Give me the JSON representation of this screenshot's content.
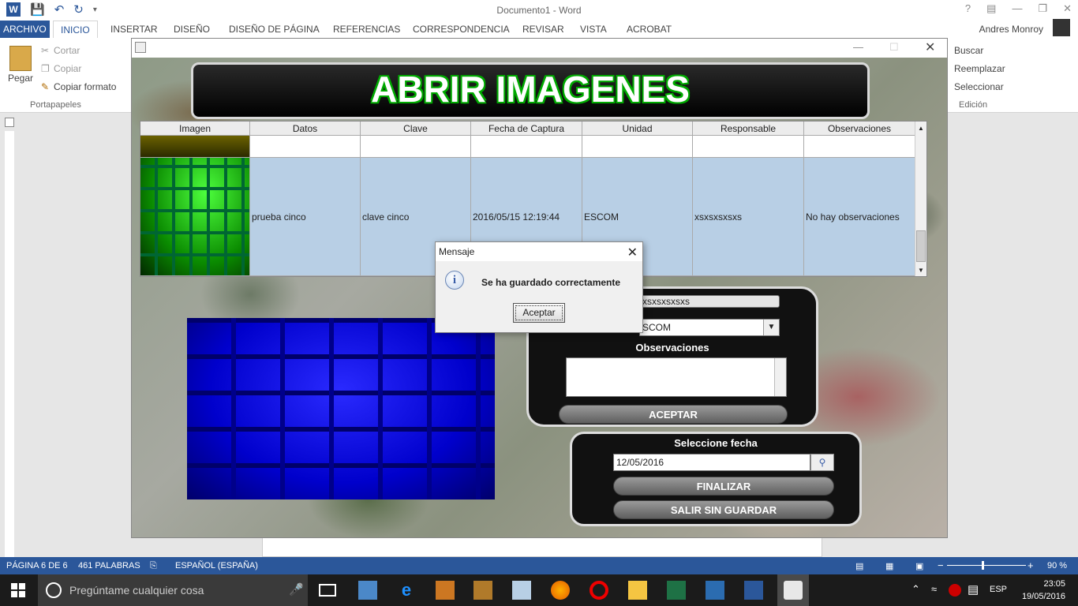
{
  "word": {
    "doc_title": "Documento1 - Word",
    "tabs": [
      "ARCHIVO",
      "INICIO",
      "INSERTAR",
      "DISEÑO",
      "DISEÑO DE PÁGINA",
      "REFERENCIAS",
      "CORRESPONDENCIA",
      "REVISAR",
      "VISTA",
      "ACROBAT"
    ],
    "user": "Andres Monroy",
    "ribbon": {
      "paste": "Pegar",
      "cut": "Cortar",
      "copy": "Copiar",
      "format_painter": "Copiar formato",
      "group_clipboard": "Portapapeles",
      "find": "Buscar",
      "replace": "Reemplazar",
      "select": "Seleccionar",
      "group_edit": "Edición"
    },
    "status": {
      "page": "PÁGINA 6 DE 6",
      "words": "461 PALABRAS",
      "language": "ESPAÑOL (ESPAÑA)",
      "zoom": "90 %"
    }
  },
  "taskbar": {
    "search_placeholder": "Pregúntame cualquier cosa",
    "lang": "ESP",
    "time": "23:05",
    "date": "19/05/2016"
  },
  "app": {
    "banner": "ABRIR IMAGENES",
    "table": {
      "headers": [
        "Imagen",
        "Datos",
        "Clave",
        "Fecha de Captura",
        "Unidad",
        "Responsable",
        "Observaciones"
      ],
      "selected_row": [
        "prueba cinco",
        "clave cinco",
        "2016/05/15 12:19:44",
        "ESCOM",
        "xsxsxsxsxs",
        "No hay observaciones"
      ]
    },
    "form": {
      "responsable_value": "xsxsxsxsxs",
      "unidad_value": "SCOM",
      "observaciones_label": "Observaciones",
      "accept_btn": "ACEPTAR",
      "date_label": "Seleccione fecha",
      "date_value": "12/05/2016",
      "finish_btn": "FINALIZAR",
      "exit_btn": "SALIR SIN GUARDAR"
    }
  },
  "dialog": {
    "title": "Mensaje",
    "message": "Se ha guardado correctamente",
    "ok": "Aceptar",
    "info_glyph": "i"
  }
}
